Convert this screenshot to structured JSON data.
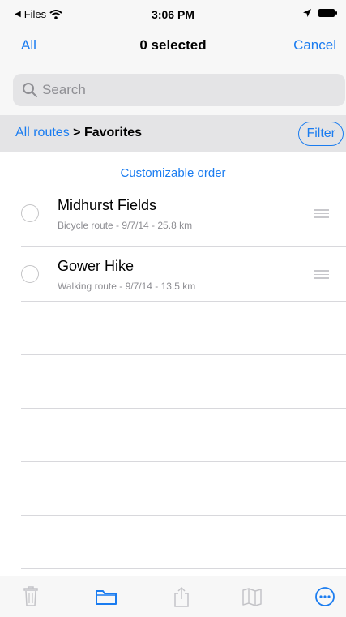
{
  "status_bar": {
    "back_app": "Files",
    "time": "3:06 PM"
  },
  "nav": {
    "all_label": "All",
    "title": "0 selected",
    "cancel_label": "Cancel"
  },
  "search": {
    "placeholder": "Search"
  },
  "breadcrumb": {
    "root": "All routes",
    "separator": " > ",
    "current": "Favorites",
    "filter_label": "Filter"
  },
  "order_label": "Customizable order",
  "routes": [
    {
      "title": "Midhurst Fields",
      "subtitle": "Bicycle route - 9/7/14 - 25.8 km",
      "selected": false
    },
    {
      "title": "Gower Hike",
      "subtitle": "Walking route - 9/7/14 - 13.5 km",
      "selected": false
    }
  ],
  "toolbar": {
    "items": [
      "trash-icon",
      "folder-icon",
      "share-icon",
      "map-icon",
      "more-icon"
    ]
  },
  "colors": {
    "accent": "#1a7cf0",
    "bar_bg": "#f7f7f7",
    "crumb_bg": "#e4e4e6",
    "secondary_text": "#8e8e93"
  }
}
